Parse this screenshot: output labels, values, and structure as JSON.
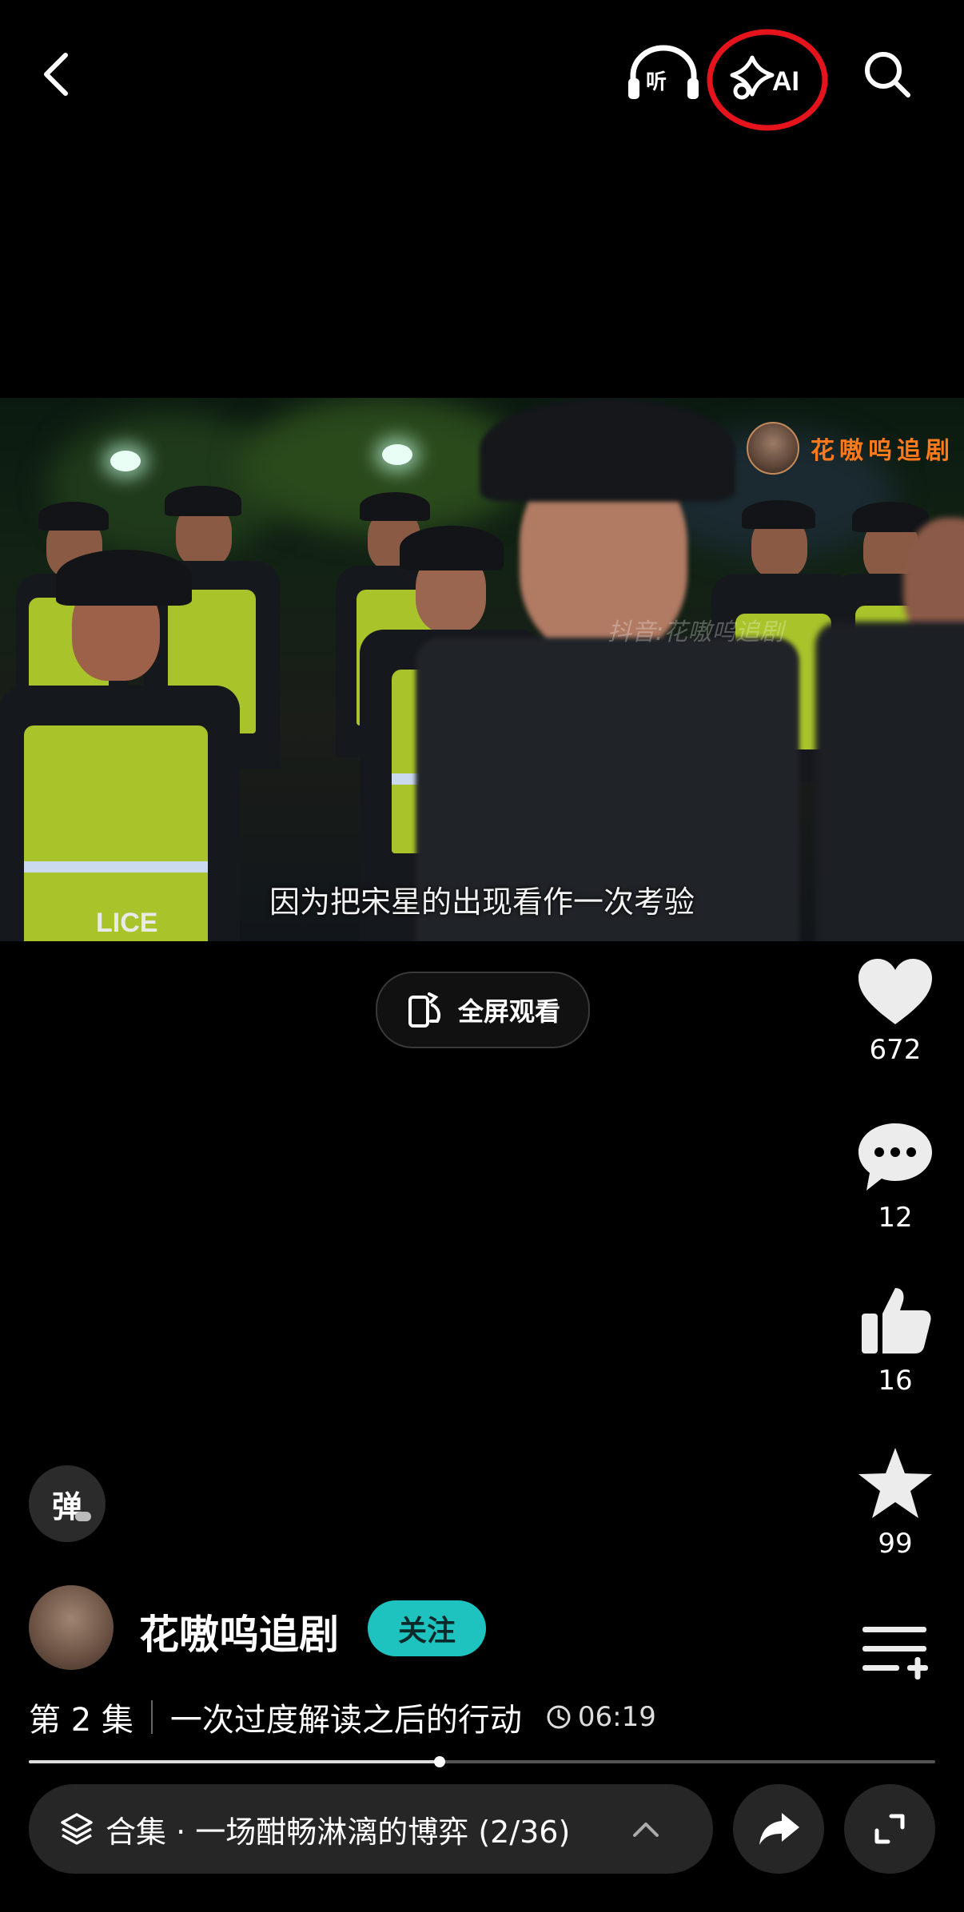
{
  "top_bar": {
    "back_icon": "chevron-left-icon",
    "listen_label": "听",
    "ai_label": "AI",
    "search_icon": "search-icon",
    "ai_highlight_color": "#e5131c"
  },
  "video": {
    "channel_badge_text": "花嗷呜追剧",
    "watermark": "抖音:花嗷呜追剧",
    "subtitle": "因为把宋星的出现看作一次考验",
    "vest_text": "LICE"
  },
  "fullscreen_button": {
    "label": "全屏观看"
  },
  "actions": {
    "like_count": "672",
    "comment_count": "12",
    "thumbs_up_count": "16",
    "favorite_count": "99"
  },
  "danmaku": {
    "label": "弹"
  },
  "author": {
    "name": "花嗷呜追剧",
    "follow_label": "关注",
    "follow_color": "#1ec3c0"
  },
  "episode": {
    "number": "第 2 集",
    "title": "一次过度解读之后的行动",
    "duration": "06:19"
  },
  "progress": {
    "fraction": 0.453
  },
  "collection": {
    "label": "合集 · 一场酣畅淋漓的博弈 (2/36)"
  }
}
